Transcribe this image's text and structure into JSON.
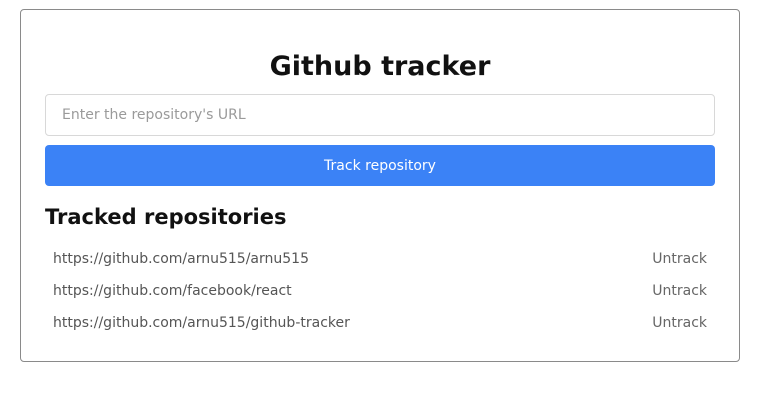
{
  "app": {
    "title": "Github tracker"
  },
  "form": {
    "url_value": "",
    "url_placeholder": "Enter the repository's URL",
    "track_label": "Track repository"
  },
  "tracked": {
    "heading": "Tracked repositories",
    "items": [
      {
        "url": "https://github.com/arnu515/arnu515",
        "action": "Untrack"
      },
      {
        "url": "https://github.com/facebook/react",
        "action": "Untrack"
      },
      {
        "url": "https://github.com/arnu515/github-tracker",
        "action": "Untrack"
      }
    ]
  },
  "colors": {
    "accent": "#3b82f6",
    "card_border": "#8a8a8a"
  }
}
